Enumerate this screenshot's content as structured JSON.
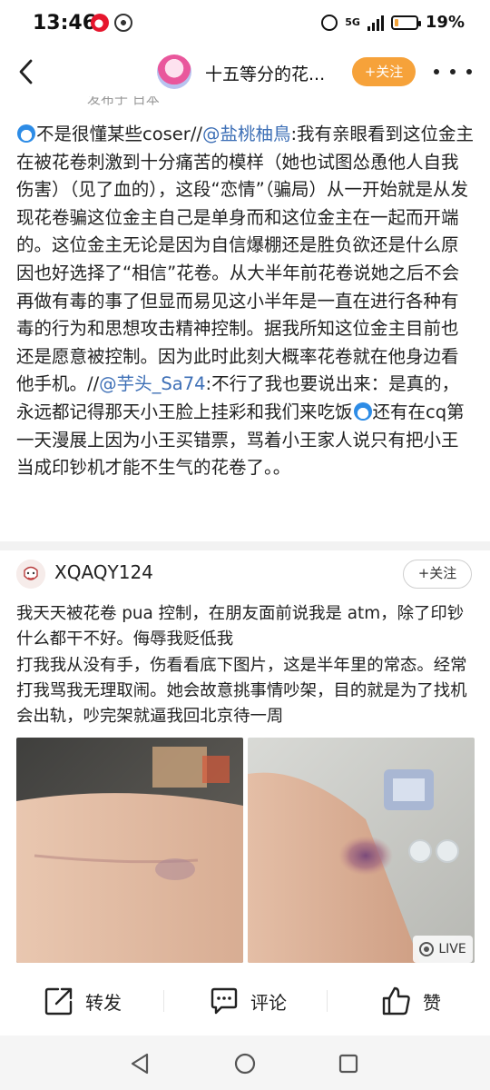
{
  "status_bar": {
    "time": "13:46",
    "network": "5G",
    "battery_percent": "19%",
    "battery_level": 0.19,
    "battery_color": "#f2a33a"
  },
  "nav": {
    "title": "十五等分的花...",
    "follow_label": "+关注",
    "follow_color": "#f6a23a"
  },
  "post": {
    "clipped_text": "发布于 日本",
    "segments": [
      {
        "type": "emoji",
        "icon": "doraemon-emoji"
      },
      {
        "type": "text",
        "text": "不是很懂某些coser//"
      },
      {
        "type": "mention",
        "text": "@盐桃柚鳥"
      },
      {
        "type": "text",
        "text": ":我有亲眼看到这位金主在被花卷刺激到十分痛苦的模样（她也试图怂恿他人自我伤害）（见了血的），这段“恋情”（骗局）从一开始就是从发现花卷骗这位金主自己是单身而和这位金主在一起而开端的。这位金主无论是因为自信爆棚还是胜负欲还是什么原因也好选择了“相信”花卷。从大半年前花卷说她之后不会再做有毒的事了但显而易见这小半年是一直在进行各种有毒的行为和思想攻击精神控制。据我所知这位金主目前也还是愿意被控制。因为此时此刻大概率花卷就在他身边看他手机。//"
      },
      {
        "type": "mention",
        "text": "@芋头_Sa74"
      },
      {
        "type": "text",
        "text": ":不行了我也要说出来：是真的，永远都记得那天小王脸上挂彩和我们来吃饭"
      },
      {
        "type": "emoji",
        "icon": "doraemon-emoji"
      },
      {
        "type": "text",
        "text": "还有在cq第一天漫展上因为小王买错票，骂着小王家人说只有把小王当成印钞机才能不生气的花卷了。。"
      }
    ],
    "mention_color": "#3d6fb6"
  },
  "comment": {
    "username": "XQAQY124",
    "follow_label": "+关注",
    "paragraphs": [
      "我天天被花卷 pua 控制，在朋友面前说我是 atm，除了印钞什么都干不好。侮辱我贬低我",
      "打我我从没有手，伤看看底下图片，这是半年里的常态。经常打我骂我无理取闹。她会故意挑事情吵架，目的就是为了找机会出轨，吵完架就逼我回北京待一周"
    ],
    "live_label": "LIVE"
  },
  "actions": {
    "repost_label": "转发",
    "comment_label": "评论",
    "like_label": "赞"
  }
}
